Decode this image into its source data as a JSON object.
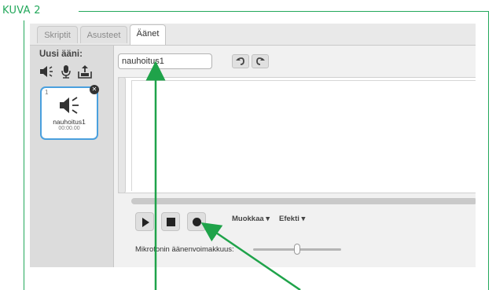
{
  "figure": {
    "label": "KUVA 2"
  },
  "tabs": [
    {
      "label": "Skriptit",
      "active": false
    },
    {
      "label": "Asusteet",
      "active": false
    },
    {
      "label": "Äänet",
      "active": true
    }
  ],
  "sidebar": {
    "new_sound_label": "Uusi ääni:",
    "sources": [
      "speaker-library-icon",
      "microphone-icon",
      "upload-icon"
    ],
    "sound": {
      "index": "1",
      "name": "nauhoitus1",
      "duration": "00:00.00"
    }
  },
  "editor": {
    "sound_name_value": "nauhoitus1",
    "menus": {
      "edit": "Muokkaa ▾",
      "effect": "Efekti ▾"
    },
    "mic_label": "Mikrofonin äänenvoimakkuus:",
    "mic_level": 0.5
  },
  "colors": {
    "frame": "#23a85b",
    "arrow": "#1fa34a",
    "selection": "#4aa0de"
  }
}
